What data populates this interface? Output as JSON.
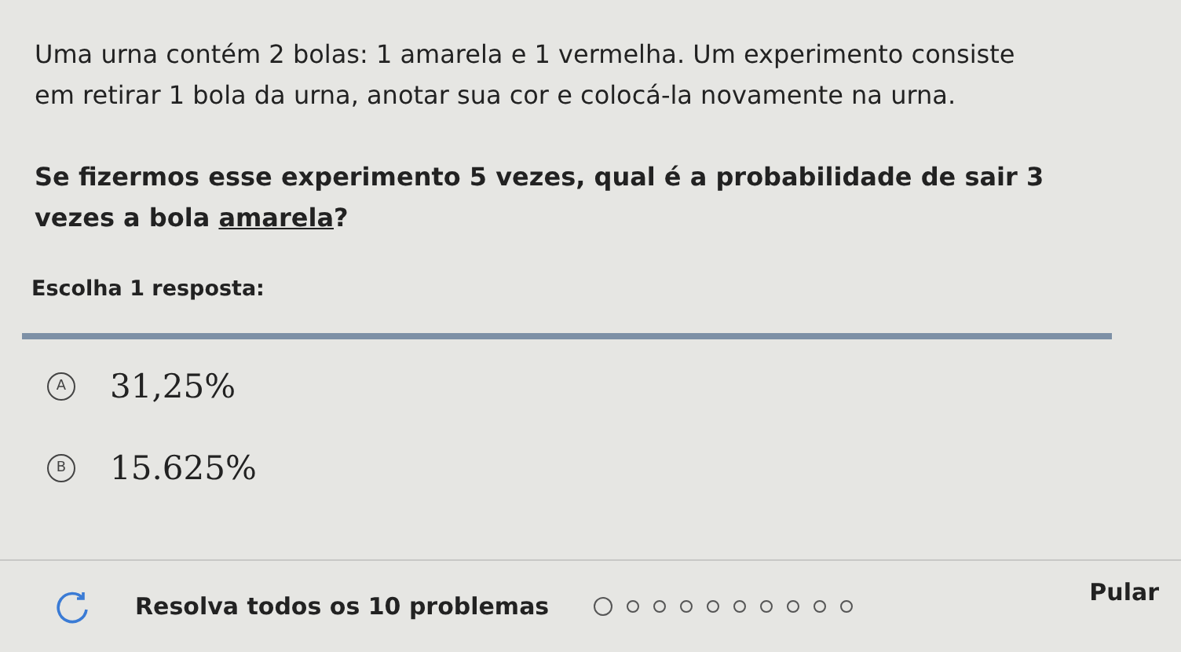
{
  "statement": "Uma urna contém 2 bolas: 1 amarela e 1 vermelha. Um experimento consiste em retirar 1 bola da urna, anotar sua cor e colocá-la novamente na urna.",
  "question": {
    "before": "Se fizermos esse experimento 5 vezes, qual é a probabilidade de sair 3 vezes a bola ",
    "underlined": "amarela",
    "after": "?"
  },
  "prompt": "Escolha 1 resposta:",
  "choices": [
    {
      "letter": "A",
      "text": "31,25%"
    },
    {
      "letter": "B",
      "text": "15.625%"
    }
  ],
  "footer": {
    "label": "Resolva todos os 10 problemas",
    "progress": [
      {
        "current": true
      },
      {
        "current": false
      },
      {
        "current": false
      },
      {
        "current": false
      },
      {
        "current": false
      },
      {
        "current": false
      },
      {
        "current": false
      },
      {
        "current": false
      },
      {
        "current": false
      },
      {
        "current": false
      }
    ],
    "skip": "Pular"
  }
}
